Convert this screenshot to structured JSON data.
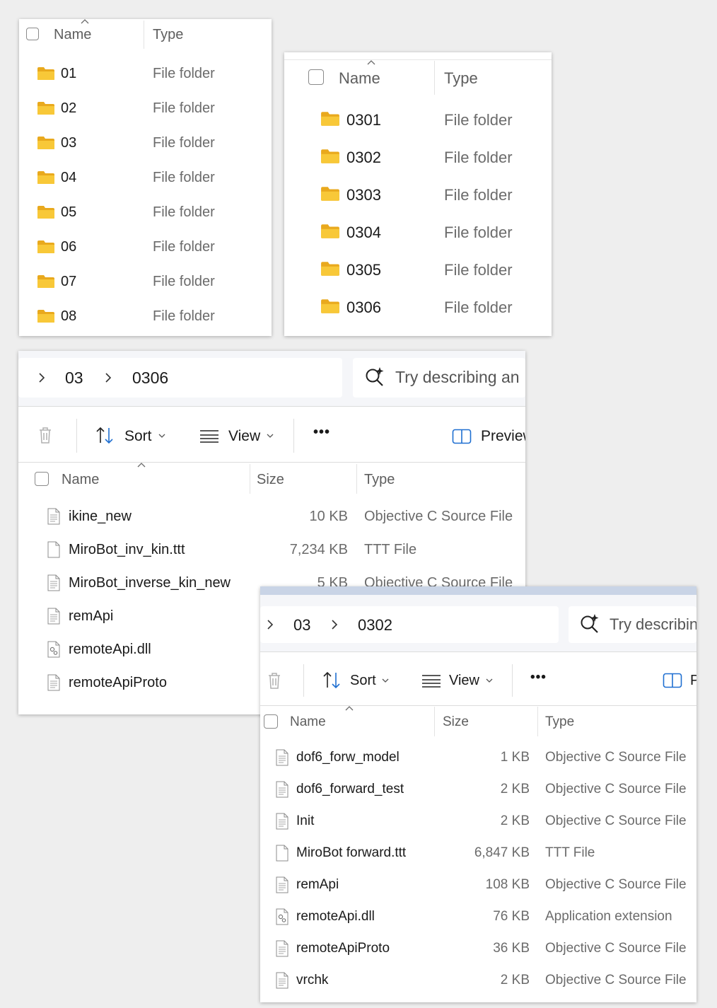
{
  "panel1": {
    "columns": {
      "name": "Name",
      "type": "Type"
    },
    "rows": [
      {
        "name": "01",
        "type": "File folder"
      },
      {
        "name": "02",
        "type": "File folder"
      },
      {
        "name": "03",
        "type": "File folder"
      },
      {
        "name": "04",
        "type": "File folder"
      },
      {
        "name": "05",
        "type": "File folder"
      },
      {
        "name": "06",
        "type": "File folder"
      },
      {
        "name": "07",
        "type": "File folder"
      },
      {
        "name": "08",
        "type": "File folder"
      }
    ]
  },
  "panel2": {
    "columns": {
      "name": "Name",
      "type": "Type"
    },
    "rows": [
      {
        "name": "0301",
        "type": "File folder"
      },
      {
        "name": "0302",
        "type": "File folder"
      },
      {
        "name": "0303",
        "type": "File folder"
      },
      {
        "name": "0304",
        "type": "File folder"
      },
      {
        "name": "0305",
        "type": "File folder"
      },
      {
        "name": "0306",
        "type": "File folder"
      }
    ]
  },
  "panel3": {
    "breadcrumb": [
      "03",
      "0306"
    ],
    "search_placeholder": "Try describing an",
    "toolbar": {
      "sort": "Sort",
      "view": "View",
      "more": "•••",
      "preview": "Preview"
    },
    "columns": {
      "name": "Name",
      "size": "Size",
      "type": "Type"
    },
    "rows": [
      {
        "name": "ikine_new",
        "size": "10 KB",
        "type": "Objective C Source File",
        "icon": "source-file-icon"
      },
      {
        "name": "MiroBot_inv_kin.ttt",
        "size": "7,234 KB",
        "type": "TTT File",
        "icon": "blank-file-icon"
      },
      {
        "name": "MiroBot_inverse_kin_new",
        "size": "5 KB",
        "type": "Objective C Source File",
        "icon": "source-file-icon"
      },
      {
        "name": "remApi",
        "size": "",
        "type": "",
        "icon": "source-file-icon"
      },
      {
        "name": "remoteApi.dll",
        "size": "",
        "type": "",
        "icon": "dll-file-icon"
      },
      {
        "name": "remoteApiProto",
        "size": "",
        "type": "",
        "icon": "source-file-icon"
      }
    ]
  },
  "panel4": {
    "breadcrumb": [
      "03",
      "0302"
    ],
    "search_placeholder": "Try describin",
    "toolbar": {
      "sort": "Sort",
      "view": "View",
      "more": "•••",
      "preview": "P"
    },
    "columns": {
      "name": "Name",
      "size": "Size",
      "type": "Type"
    },
    "rows": [
      {
        "name": "dof6_forw_model",
        "size": "1 KB",
        "type": "Objective C Source File",
        "icon": "source-file-icon"
      },
      {
        "name": "dof6_forward_test",
        "size": "2 KB",
        "type": "Objective C Source File",
        "icon": "source-file-icon"
      },
      {
        "name": "Init",
        "size": "2 KB",
        "type": "Objective C Source File",
        "icon": "source-file-icon"
      },
      {
        "name": "MiroBot forward.ttt",
        "size": "6,847 KB",
        "type": "TTT File",
        "icon": "blank-file-icon"
      },
      {
        "name": "remApi",
        "size": "108 KB",
        "type": "Objective C Source File",
        "icon": "source-file-icon"
      },
      {
        "name": "remoteApi.dll",
        "size": "76 KB",
        "type": "Application extension",
        "icon": "dll-file-icon"
      },
      {
        "name": "remoteApiProto",
        "size": "36 KB",
        "type": "Objective C Source File",
        "icon": "source-file-icon"
      },
      {
        "name": "vrchk",
        "size": "2 KB",
        "type": "Objective C Source File",
        "icon": "source-file-icon"
      }
    ]
  },
  "colors": {
    "folder": "#f8c838",
    "folder_tab": "#e9a91d",
    "accent": "#1f6fd1",
    "header_text": "#5e5e5e"
  }
}
